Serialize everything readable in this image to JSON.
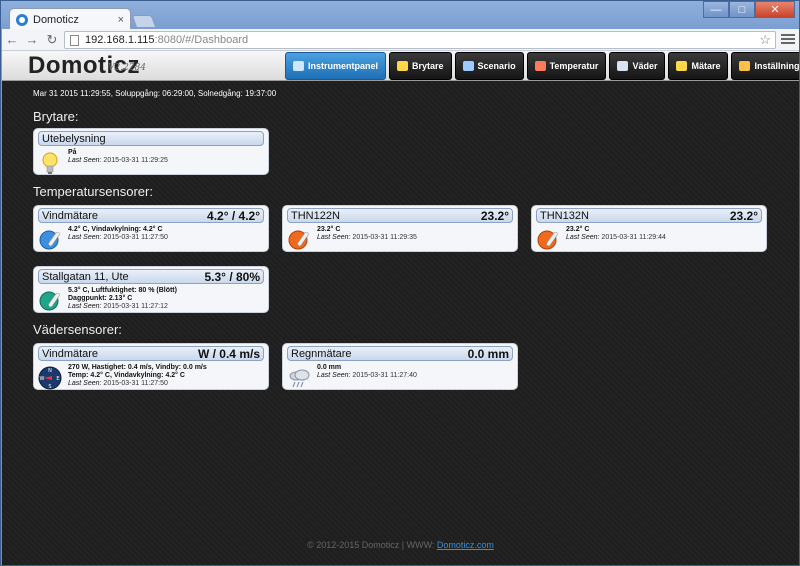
{
  "browser": {
    "tab_title": "Domoticz",
    "tab_close": "×",
    "url_host": "192.168.1.115",
    "url_path": ":8080/#/Dashboard",
    "win_min": "—",
    "win_max": "□",
    "win_close": "✕"
  },
  "app": {
    "brand": "Domoticz",
    "version": "V2.2284",
    "nav": [
      {
        "label": "Instrumentpanel",
        "icon": "dashboard-icon",
        "active": true
      },
      {
        "label": "Brytare",
        "icon": "lightbulb-icon"
      },
      {
        "label": "Scenario",
        "icon": "scene-icon"
      },
      {
        "label": "Temperatur",
        "icon": "thermometer-icon"
      },
      {
        "label": "Väder",
        "icon": "cloud-icon"
      },
      {
        "label": "Mätare",
        "icon": "lightning-icon"
      },
      {
        "label": "Inställningar",
        "icon": "tools-icon",
        "dropdown": "▾"
      }
    ]
  },
  "status_line": "Mar 31 2015 11:29:55, Soluppgång: 06:29:00, Solnedgång: 19:37:00",
  "sections": {
    "switches": "Brytare:",
    "temps": "Temperatursensorer:",
    "weather": "Vädersensorer:"
  },
  "cards": {
    "utebelysning": {
      "name": "Utebelysning",
      "state": "På",
      "seen_label": "Last Seen:",
      "seen": "2015-03-31 11:29:25"
    },
    "vind_temp": {
      "name": "Vindmätare",
      "value": "4.2° / 4.2°",
      "line1": "4.2° C, Vindavkylning: 4.2° C",
      "seen_label": "Last Seen:",
      "seen": "2015-03-31 11:27:50"
    },
    "thn122n": {
      "name": "THN122N",
      "value": "23.2°",
      "line1": "23.2° C",
      "seen_label": "Last Seen:",
      "seen": "2015-03-31 11:29:35"
    },
    "thn132n": {
      "name": "THN132N",
      "value": "23.2°",
      "line1": "23.2° C",
      "seen_label": "Last Seen:",
      "seen": "2015-03-31 11:29:44"
    },
    "stallgatan": {
      "name": "Stallgatan 11, Ute",
      "value": "5.3° / 80%",
      "line1": "5.3° C, Luftfuktighet: 80 % (Blött)",
      "line2": "Daggpunkt: 2.13° C",
      "seen_label": "Last Seen:",
      "seen": "2015-03-31 11:27:12"
    },
    "vind": {
      "name": "Vindmätare",
      "value": "W / 0.4 m/s",
      "line1": "270 W, Hastighet: 0.4 m/s, Vindby: 0.0 m/s",
      "line2": "Temp: 4.2° C, Vindavkylning: 4.2° C",
      "seen_label": "Last Seen:",
      "seen": "2015-03-31 11:27:50",
      "compass_n": "N",
      "compass_s": "S",
      "compass_w": "W",
      "compass_e": "E"
    },
    "regn": {
      "name": "Regnmätare",
      "value": "0.0 mm",
      "line1": "0.0 mm",
      "seen_label": "Last Seen:",
      "seen": "2015-03-31 11:27:40"
    }
  },
  "footer": {
    "text": "© 2012-2015 Domoticz | WWW: ",
    "link": "Domoticz.com"
  }
}
